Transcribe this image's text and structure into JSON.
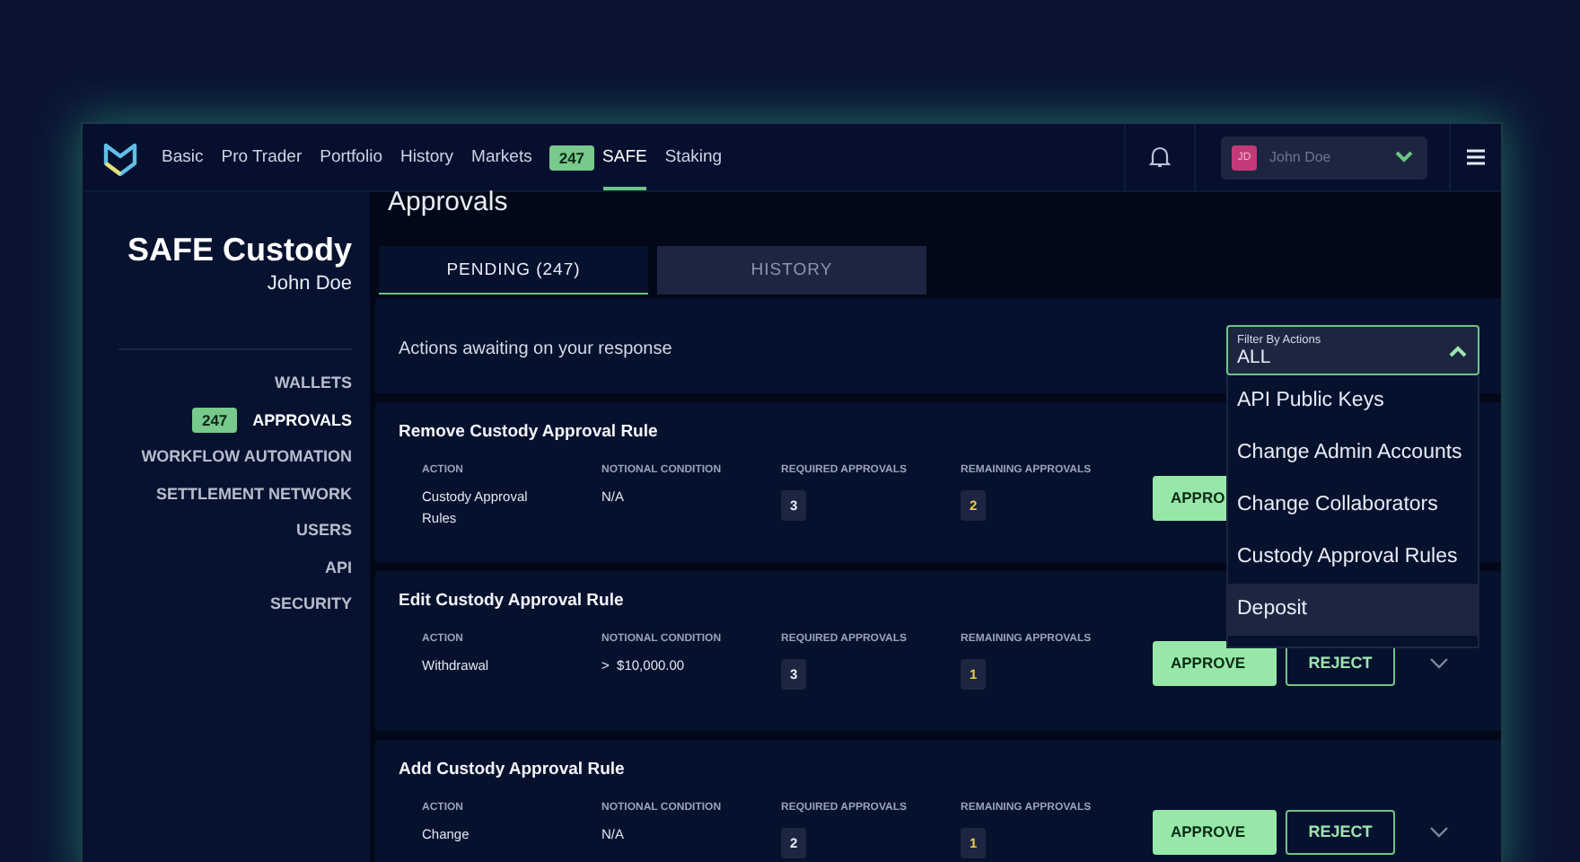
{
  "nav": {
    "items": [
      {
        "label": "Basic",
        "selected": false
      },
      {
        "label": "Pro Trader",
        "selected": false
      },
      {
        "label": "Portfolio",
        "selected": false
      },
      {
        "label": "History",
        "selected": false
      },
      {
        "label": "Markets",
        "selected": false
      },
      {
        "label": "SAFE",
        "badge": "247",
        "selected": true
      },
      {
        "label": "Staking",
        "selected": false
      }
    ],
    "user": {
      "initials": "JD",
      "name": "John Doe"
    }
  },
  "sidebar": {
    "title": "SAFE Custody",
    "subtitle": "John Doe",
    "items": [
      {
        "label": "WALLETS",
        "selected": false
      },
      {
        "label": "APPROVALS",
        "badge": "247",
        "selected": true
      },
      {
        "label": "WORKFLOW AUTOMATION",
        "selected": false
      },
      {
        "label": "SETTLEMENT NETWORK",
        "selected": false
      },
      {
        "label": "USERS",
        "selected": false
      },
      {
        "label": "API",
        "selected": false
      },
      {
        "label": "SECURITY",
        "selected": false
      }
    ]
  },
  "page": {
    "title": "Approvals"
  },
  "tabs": [
    {
      "label": "PENDING (247)",
      "selected": true
    },
    {
      "label": "HISTORY",
      "selected": false
    }
  ],
  "filter": {
    "caption": "Actions awaiting on your response",
    "label": "Filter By Actions",
    "value": "ALL",
    "expanded": true,
    "options": [
      {
        "label": "API Public Keys",
        "highlighted": false
      },
      {
        "label": "Change Admin Accounts",
        "highlighted": false
      },
      {
        "label": "Change Collaborators",
        "highlighted": false
      },
      {
        "label": "Custody Approval Rules",
        "highlighted": false
      },
      {
        "label": "Deposit",
        "highlighted": true
      }
    ]
  },
  "cards": [
    {
      "title": "Remove Custody Approval Rule",
      "fields": [
        {
          "kind": "text",
          "label": "ACTION",
          "value": "Custody Approval Rules"
        },
        {
          "kind": "text",
          "label": "NOTIONAL CONDITION",
          "value": "N/A"
        },
        {
          "kind": "count",
          "label": "REQUIRED APPROVALS",
          "value": "3"
        },
        {
          "kind": "remaining",
          "label": "REMAINING APPROVALS",
          "value": "2"
        }
      ],
      "approve": "APPRO"
    },
    {
      "title": "Edit Custody Approval Rule",
      "fields": [
        {
          "kind": "text",
          "label": "ACTION",
          "value": "Withdrawal"
        },
        {
          "kind": "text",
          "label": "NOTIONAL CONDITION",
          "value": ">  $10,000.00"
        },
        {
          "kind": "count",
          "label": "REQUIRED APPROVALS",
          "value": "3"
        },
        {
          "kind": "remaining",
          "label": "REMAINING APPROVALS",
          "value": "1"
        }
      ],
      "approve": "APPROVE",
      "reject": "REJECT"
    },
    {
      "title": "Add Custody Approval Rule",
      "fields": [
        {
          "kind": "text",
          "label": "ACTION",
          "value": "Change"
        },
        {
          "kind": "text",
          "label": "NOTIONAL CONDITION",
          "value": "N/A"
        },
        {
          "kind": "count",
          "label": "REQUIRED APPROVALS",
          "value": "2"
        },
        {
          "kind": "remaining",
          "label": "REMAINING APPROVALS",
          "value": "1"
        }
      ],
      "approve": "APPROVE",
      "reject": "REJECT"
    }
  ]
}
